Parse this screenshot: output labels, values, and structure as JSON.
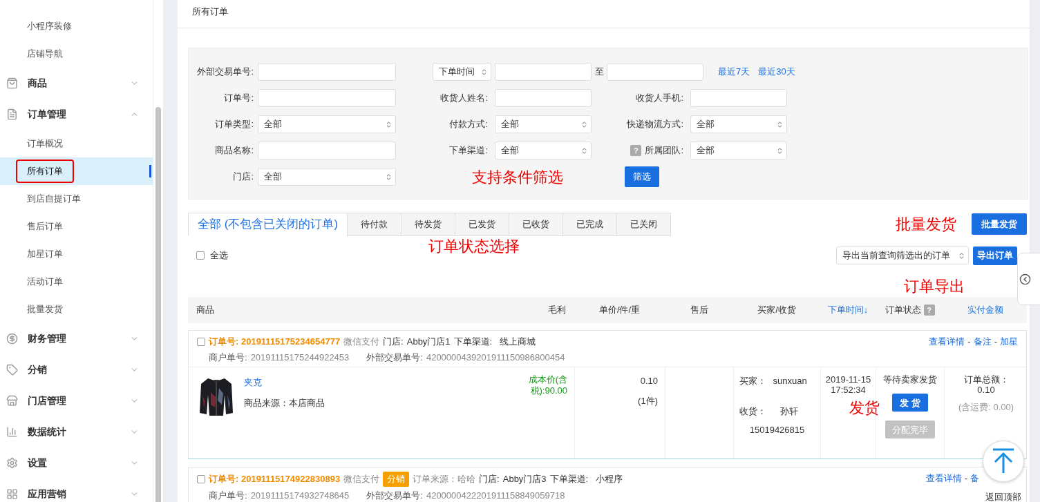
{
  "sidebar": {
    "items": [
      {
        "kind": "sub",
        "label": "小程序装修",
        "selected": false
      },
      {
        "kind": "sub",
        "label": "店铺导航",
        "selected": false
      },
      {
        "kind": "group",
        "label": "商品",
        "expanded": false
      },
      {
        "kind": "group",
        "label": "订单管理",
        "expanded": true,
        "children": [
          {
            "label": "订单概况",
            "selected": false
          },
          {
            "label": "所有订单",
            "selected": true
          },
          {
            "label": "到店自提订单",
            "selected": false
          },
          {
            "label": "售后订单",
            "selected": false
          },
          {
            "label": "加星订单",
            "selected": false
          },
          {
            "label": "活动订单",
            "selected": false
          },
          {
            "label": "批量发货",
            "selected": false
          }
        ]
      },
      {
        "kind": "group",
        "label": "财务管理",
        "expanded": false
      },
      {
        "kind": "group",
        "label": "分销",
        "expanded": false
      },
      {
        "kind": "group",
        "label": "门店管理",
        "expanded": false
      },
      {
        "kind": "group",
        "label": "数据统计",
        "expanded": false
      },
      {
        "kind": "group",
        "label": "设置",
        "expanded": false
      },
      {
        "kind": "group",
        "label": "应用营销",
        "expanded": false
      }
    ]
  },
  "page_title": "所有订单",
  "filters": {
    "date_type": "下单时间",
    "to": "至",
    "quick_links": [
      "最近7天",
      "最近30天"
    ],
    "button": "筛选",
    "help_mark": "?",
    "rows": [
      [
        {
          "label": "外部交易单号:",
          "kind": "input"
        }
      ],
      [
        {
          "label": "订单号:",
          "kind": "input"
        },
        {
          "label": "收货人姓名:",
          "kind": "input"
        },
        {
          "label": "收货人手机:",
          "kind": "input"
        }
      ],
      [
        {
          "label": "订单类型:",
          "kind": "select",
          "value": "全部"
        },
        {
          "label": "付款方式:",
          "kind": "select",
          "value": "全部"
        },
        {
          "label": "快递物流方式:",
          "kind": "select",
          "value": "全部"
        }
      ],
      [
        {
          "label": "商品名称:",
          "kind": "input"
        },
        {
          "label": "下单渠道:",
          "kind": "select",
          "value": "全部"
        },
        {
          "label": "所属团队:",
          "kind": "select",
          "value": "全部",
          "help": true
        }
      ],
      [
        {
          "label": "门店:",
          "kind": "select",
          "value": "全部"
        }
      ]
    ]
  },
  "annotations": {
    "filter": "支持条件筛选",
    "tabs": "订单状态选择",
    "batch": "批量发货",
    "export": "订单导出",
    "ship": "发货"
  },
  "tabs": [
    {
      "label": "全部 (不包含已关闭的订单)",
      "selected": true
    },
    {
      "label": "待付款",
      "selected": false
    },
    {
      "label": "待发货",
      "selected": false
    },
    {
      "label": "已发货",
      "selected": false
    },
    {
      "label": "已收货",
      "selected": false
    },
    {
      "label": "已完成",
      "selected": false
    },
    {
      "label": "已关闭",
      "selected": false
    }
  ],
  "batch_button": "批量发货",
  "select_all": {
    "label": "全选",
    "checked": false
  },
  "export_select": "导出当前查询筛选出的订单",
  "export_button": "导出订单",
  "columns": [
    {
      "label": "商品",
      "kind": "plain"
    },
    {
      "label": "毛利",
      "kind": "plain"
    },
    {
      "label": "单价/件/重",
      "kind": "plain"
    },
    {
      "label": "售后",
      "kind": "plain"
    },
    {
      "label": "买家/收货",
      "kind": "plain"
    },
    {
      "label": "下单时间↓",
      "kind": "link"
    },
    {
      "label": "订单状态",
      "kind": "help"
    },
    {
      "label": "实付金额",
      "kind": "link"
    }
  ],
  "action_separator": "-",
  "orders": [
    {
      "checked": false,
      "order_no": "订单号: 20191115175234654777",
      "payment": "微信支付",
      "store_label": "门店:",
      "store": "Abby门店1",
      "channel_label": "下单渠道:",
      "channel": "线上商城",
      "merchant_label": "商户单号:",
      "merchant_no": "20191115175244922453",
      "ext_label": "外部交易单号:",
      "ext_no": "4200000439201911150986800454",
      "actions": [
        "查看详情",
        "备注",
        "加星"
      ],
      "item": {
        "name": "夹克",
        "source": "商品来源：本店商品",
        "cost": "成本价(含税):90.00",
        "price": "0.10",
        "qty": "(1件)",
        "buyer_label": "买家：",
        "buyer": "sunxuan",
        "receiver_label": "收货：",
        "receiver": "孙轩",
        "phone": "15019426815",
        "date": "2019-11-15",
        "time": "17:52:34",
        "status": "等待卖家发货",
        "ship_button": "发 货",
        "assign_button": "分配完毕",
        "assign_disabled": true,
        "total_label": "订单总额：",
        "total": "0.10",
        "shipping": "(含运费: 0.00)"
      }
    },
    {
      "checked": false,
      "order_no": "订单号: 20191115174922830893",
      "payment": "微信支付",
      "tag": "分销",
      "source": "订单来源：哈哈",
      "store_label": "门店:",
      "store": "Abby门店3",
      "channel_label": "下单渠道:",
      "channel": "小程序",
      "merchant_label": "商户单号:",
      "merchant_no": "20191115174932748645",
      "ext_label": "外部交易单号:",
      "ext_no": "4200000422201911158849059718",
      "actions": [
        "查看详情",
        "备"
      ]
    }
  ],
  "back_to_top": "返回顶部"
}
